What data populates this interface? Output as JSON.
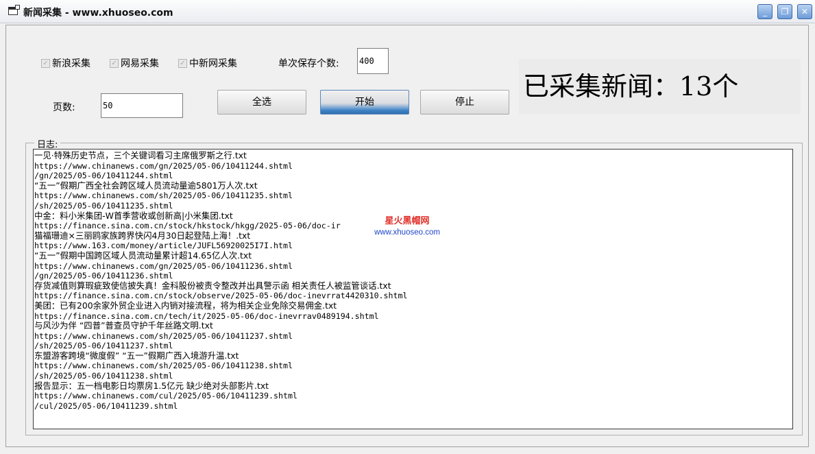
{
  "window": {
    "title": "新闻采集 - www.xhuoseo.com"
  },
  "options": {
    "sina": "新浪采集",
    "netease": "网易采集",
    "chinanews": "中新网采集",
    "save_count_label": "单次保存个数:",
    "save_count_value": "400",
    "pages_label": "页数:",
    "pages_value": "50"
  },
  "buttons": {
    "select_all": "全选",
    "start": "开始",
    "stop": "停止"
  },
  "counter": "已采集新闻：13个",
  "log": {
    "label": "日志:",
    "lines": [
      "一见·特殊历史节点，三个关键词看习主席俄罗斯之行.txt",
      "https://www.chinanews.com/gn/2025/05-06/10411244.shtml",
      "/gn/2025/05-06/10411244.shtml",
      "“五一”假期广西全社会跨区域人员流动量逾5801万人次.txt",
      "https://www.chinanews.com/sh/2025/05-06/10411235.shtml",
      "/sh/2025/05-06/10411235.shtml",
      "中金：料小米集团-W首季营收或创新高|小米集团.txt",
      "https://finance.sina.com.cn/stock/hkstock/hkgg/2025-05-06/doc-ir                l",
      "猫福珊迪×三丽鸥家族跨界快闪4月30日起登陆上海！.txt",
      "https://www.163.com/money/article/JUFL56920025I7I.html",
      "“五一”假期中国跨区域人员流动量累计超14.65亿人次.txt",
      "https://www.chinanews.com/gn/2025/05-06/10411236.shtml",
      "/gn/2025/05-06/10411236.shtml",
      "存货减值则算瑕疵致使信披失真！金科股份被责令整改并出具警示函 相关责任人被监管谈话.txt",
      "https://finance.sina.com.cn/stock/observe/2025-05-06/doc-inevrrat4420310.shtml",
      "美团：已有200余家外贸企业进入内销对接流程，将为相关企业免除交易佣金.txt",
      "https://finance.sina.com.cn/tech/it/2025-05-06/doc-inevrrav0489194.shtml",
      "与风沙为伴 “四普”普查员守护千年丝路文明.txt",
      "https://www.chinanews.com/sh/2025/05-06/10411237.shtml",
      "/sh/2025/05-06/10411237.shtml",
      "东盟游客跨境“微度假” “五一”假期广西入境游升温.txt",
      "https://www.chinanews.com/sh/2025/05-06/10411238.shtml",
      "/sh/2025/05-06/10411238.shtml",
      "报告显示：五一档电影日均票房1.5亿元 缺少绝对头部影片.txt",
      "https://www.chinanews.com/cul/2025/05-06/10411239.shtml",
      "/cul/2025/05-06/10411239.shtml"
    ]
  },
  "watermark": {
    "line1": "星火黑帽网",
    "line2": "www.xhuoseo.com"
  },
  "colors": {
    "start_accent": "#2f6fb0",
    "watermark_red": "#e0302a",
    "watermark_blue": "#1f45c8"
  }
}
